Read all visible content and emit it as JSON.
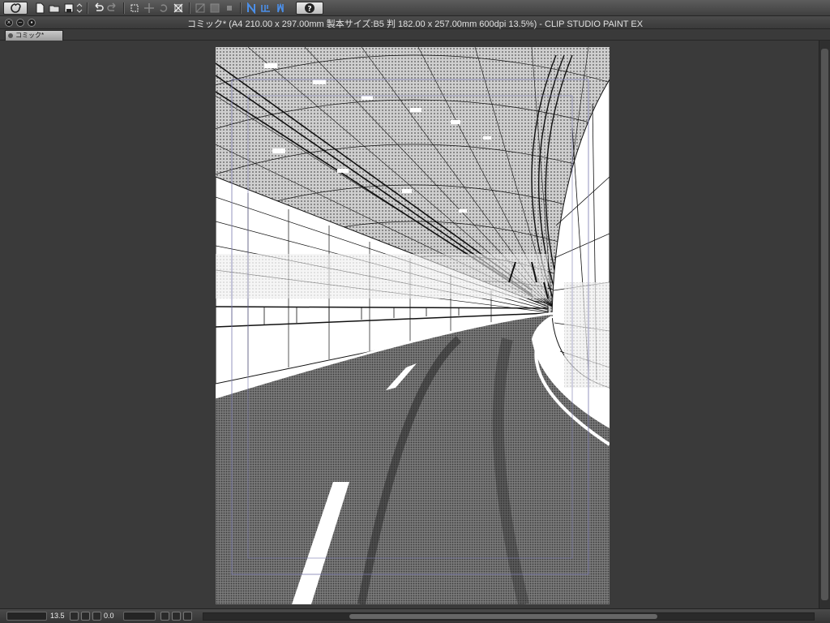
{
  "app": {
    "window_title": "コミック* (A4 210.00 x 297.00mm 製本サイズ:B5 判 182.00 x 257.00mm 600dpi 13.5%)  - CLIP STUDIO PAINT EX"
  },
  "toolbar": {
    "icons": [
      "clip-studio-logo-icon",
      "new-file-icon",
      "open-file-icon",
      "save-icon",
      "undo-icon",
      "redo-icon",
      "transform-icon",
      "pan-icon",
      "rotate-icon",
      "fit-icon",
      "mask-icon",
      "fill-icon",
      "snap-ruler-icon",
      "snap-grid-icon",
      "snap-perspective-icon",
      "help-icon"
    ]
  },
  "tab": {
    "label": "コミック*"
  },
  "status": {
    "zoom_value": "13.5",
    "rotation_value": "0.0"
  },
  "colors": {
    "ui_background": "#3b3b3b",
    "toolbar_top": "#5d5d5d",
    "page": "#ffffff",
    "ink": "#111111",
    "road_tone": "#6e6e6e"
  }
}
